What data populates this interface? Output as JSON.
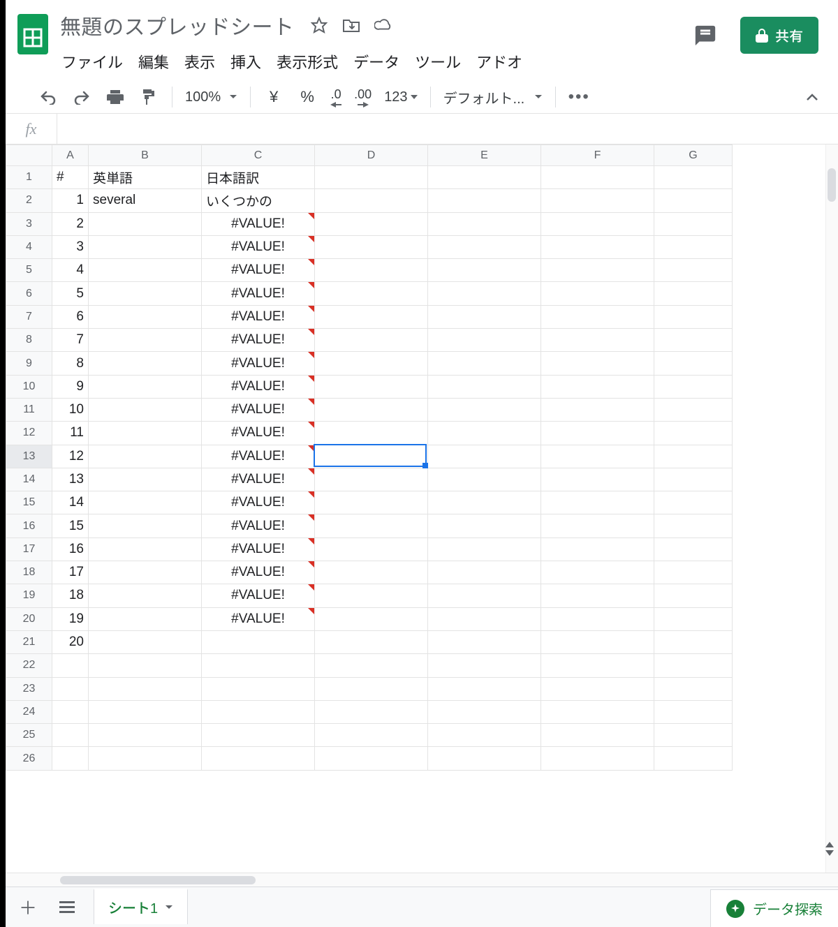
{
  "doc": {
    "title": "無題のスプレッドシート"
  },
  "menu": {
    "file": "ファイル",
    "edit": "編集",
    "view": "表示",
    "insert": "挿入",
    "format": "表示形式",
    "data": "データ",
    "tools": "ツール",
    "addons": "アドオ"
  },
  "share": {
    "label": "共有"
  },
  "toolbar": {
    "zoom": "100%",
    "currency": "¥",
    "percent": "%",
    "dec_less": ".0",
    "dec_more": ".00",
    "numfmt": "123",
    "font": "デフォルト..."
  },
  "columns": [
    "A",
    "B",
    "C",
    "D",
    "E",
    "F",
    "G"
  ],
  "selected_cell": {
    "col": "D",
    "row": 13
  },
  "rows": [
    {
      "n": 1,
      "A": "#",
      "B": "英単語",
      "C": "日本語訳",
      "C_align": "left",
      "err": false
    },
    {
      "n": 2,
      "A": "1",
      "B": "several",
      "C": "いくつかの",
      "C_align": "left",
      "err": false
    },
    {
      "n": 3,
      "A": "2",
      "B": "",
      "C": "#VALUE!",
      "C_align": "center",
      "err": true
    },
    {
      "n": 4,
      "A": "3",
      "B": "",
      "C": "#VALUE!",
      "C_align": "center",
      "err": true
    },
    {
      "n": 5,
      "A": "4",
      "B": "",
      "C": "#VALUE!",
      "C_align": "center",
      "err": true
    },
    {
      "n": 6,
      "A": "5",
      "B": "",
      "C": "#VALUE!",
      "C_align": "center",
      "err": true
    },
    {
      "n": 7,
      "A": "6",
      "B": "",
      "C": "#VALUE!",
      "C_align": "center",
      "err": true
    },
    {
      "n": 8,
      "A": "7",
      "B": "",
      "C": "#VALUE!",
      "C_align": "center",
      "err": true
    },
    {
      "n": 9,
      "A": "8",
      "B": "",
      "C": "#VALUE!",
      "C_align": "center",
      "err": true
    },
    {
      "n": 10,
      "A": "9",
      "B": "",
      "C": "#VALUE!",
      "C_align": "center",
      "err": true
    },
    {
      "n": 11,
      "A": "10",
      "B": "",
      "C": "#VALUE!",
      "C_align": "center",
      "err": true
    },
    {
      "n": 12,
      "A": "11",
      "B": "",
      "C": "#VALUE!",
      "C_align": "center",
      "err": true
    },
    {
      "n": 13,
      "A": "12",
      "B": "",
      "C": "#VALUE!",
      "C_align": "center",
      "err": true
    },
    {
      "n": 14,
      "A": "13",
      "B": "",
      "C": "#VALUE!",
      "C_align": "center",
      "err": true
    },
    {
      "n": 15,
      "A": "14",
      "B": "",
      "C": "#VALUE!",
      "C_align": "center",
      "err": true
    },
    {
      "n": 16,
      "A": "15",
      "B": "",
      "C": "#VALUE!",
      "C_align": "center",
      "err": true
    },
    {
      "n": 17,
      "A": "16",
      "B": "",
      "C": "#VALUE!",
      "C_align": "center",
      "err": true
    },
    {
      "n": 18,
      "A": "17",
      "B": "",
      "C": "#VALUE!",
      "C_align": "center",
      "err": true
    },
    {
      "n": 19,
      "A": "18",
      "B": "",
      "C": "#VALUE!",
      "C_align": "center",
      "err": true
    },
    {
      "n": 20,
      "A": "19",
      "B": "",
      "C": "#VALUE!",
      "C_align": "center",
      "err": true
    },
    {
      "n": 21,
      "A": "20",
      "B": "",
      "C": "",
      "C_align": "left",
      "err": false
    },
    {
      "n": 22,
      "A": "",
      "B": "",
      "C": "",
      "C_align": "left",
      "err": false
    },
    {
      "n": 23,
      "A": "",
      "B": "",
      "C": "",
      "C_align": "left",
      "err": false
    },
    {
      "n": 24,
      "A": "",
      "B": "",
      "C": "",
      "C_align": "left",
      "err": false
    },
    {
      "n": 25,
      "A": "",
      "B": "",
      "C": "",
      "C_align": "left",
      "err": false
    },
    {
      "n": 26,
      "A": "",
      "B": "",
      "C": "",
      "C_align": "left",
      "err": false
    }
  ],
  "sheet": {
    "tab": "シート1",
    "explore": "データ探索"
  }
}
